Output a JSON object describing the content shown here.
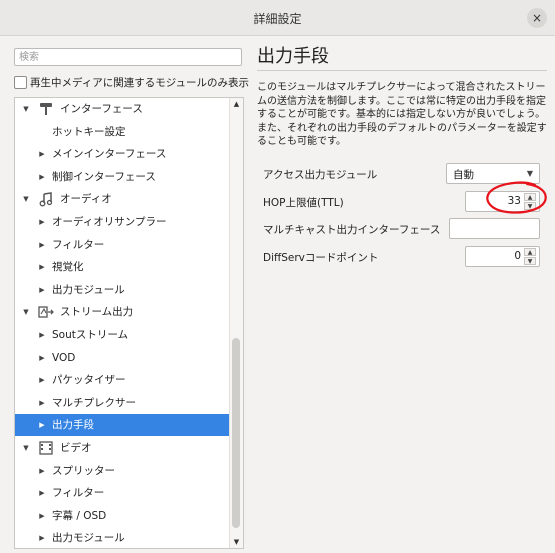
{
  "window": {
    "title": "詳細設定",
    "close_glyph": "×"
  },
  "search": {
    "placeholder": "検索",
    "value": ""
  },
  "filter_checkbox": {
    "label": "再生中メディアに関連するモジュールのみ表示",
    "checked": false
  },
  "tree": {
    "items": [
      {
        "label": "インターフェース",
        "level": 0,
        "expanded": true,
        "icon": "interface-icon",
        "selected": false
      },
      {
        "label": "ホットキー設定",
        "level": 1,
        "expanded": null,
        "selected": false
      },
      {
        "label": "メインインターフェース",
        "level": 1,
        "expanded": false,
        "selected": false
      },
      {
        "label": "制御インターフェース",
        "level": 1,
        "expanded": false,
        "selected": false
      },
      {
        "label": "オーディオ",
        "level": 0,
        "expanded": true,
        "icon": "audio-icon",
        "selected": false
      },
      {
        "label": "オーディオリサンプラー",
        "level": 1,
        "expanded": false,
        "selected": false
      },
      {
        "label": "フィルター",
        "level": 1,
        "expanded": false,
        "selected": false
      },
      {
        "label": "視覚化",
        "level": 1,
        "expanded": false,
        "selected": false
      },
      {
        "label": "出力モジュール",
        "level": 1,
        "expanded": false,
        "selected": false
      },
      {
        "label": "ストリーム出力",
        "level": 0,
        "expanded": true,
        "icon": "stream-output-icon",
        "selected": false
      },
      {
        "label": "Soutストリーム",
        "level": 1,
        "expanded": false,
        "selected": false
      },
      {
        "label": "VOD",
        "level": 1,
        "expanded": false,
        "selected": false
      },
      {
        "label": "パケッタイザー",
        "level": 1,
        "expanded": false,
        "selected": false
      },
      {
        "label": "マルチプレクサー",
        "level": 1,
        "expanded": false,
        "selected": false
      },
      {
        "label": "出力手段",
        "level": 1,
        "expanded": false,
        "selected": true
      },
      {
        "label": "ビデオ",
        "level": 0,
        "expanded": true,
        "icon": "video-icon",
        "selected": false
      },
      {
        "label": "スプリッター",
        "level": 1,
        "expanded": false,
        "selected": false
      },
      {
        "label": "フィルター",
        "level": 1,
        "expanded": false,
        "selected": false
      },
      {
        "label": "字幕 / OSD",
        "level": 1,
        "expanded": false,
        "selected": false
      },
      {
        "label": "出力モジュール",
        "level": 1,
        "expanded": false,
        "selected": false
      }
    ]
  },
  "panel": {
    "title": "出力手段",
    "description": "このモジュールはマルチプレクサーによって混合されたストリームの送信方法を制御します。ここでは常に特定の出力手段を指定することが可能です。基本的には指定しない方が良いでしょう。また、それぞれの出力手段のデフォルトのパラメーターを設定することも可能です。",
    "options": {
      "access_output": {
        "label": "アクセス出力モジュール",
        "value": "自動"
      },
      "hop_limit": {
        "label": "HOP上限値(TTL)",
        "value": "33"
      },
      "multicast_iface": {
        "label": "マルチキャスト出力インターフェース",
        "value": ""
      },
      "diffserv": {
        "label": "DiffServコードポイント",
        "value": "0"
      }
    }
  },
  "annotation": {
    "color": "#e8141c"
  }
}
